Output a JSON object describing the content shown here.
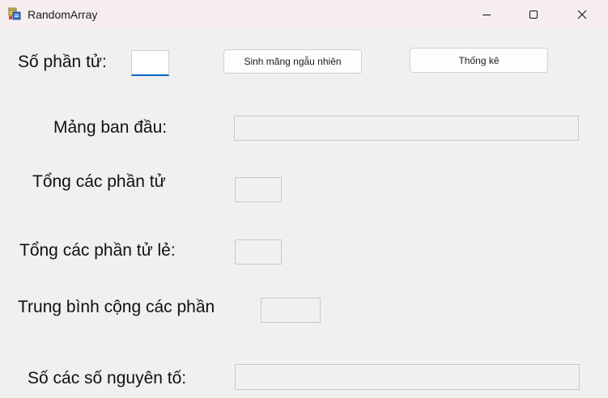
{
  "window": {
    "title": "RandomArray"
  },
  "form": {
    "element_count_label": "Số phần tử:",
    "element_count_value": "",
    "generate_button": "Sinh mãng ngẫu nhiên",
    "stats_button": "Thống kê",
    "original_array_label": "Mảng ban đầu:",
    "original_array_value": "",
    "sum_label": "Tổng các phần tử",
    "sum_value": "",
    "odd_sum_label": "Tổng các phần tử lẻ:",
    "odd_sum_value": "",
    "average_label": "Trung bình cộng các phần",
    "average_value": "",
    "prime_count_label": "Số các số nguyên tố:",
    "prime_count_value": ""
  },
  "icons": {
    "app": "app-form-icon",
    "minimize": "minimize-icon",
    "maximize": "maximize-icon",
    "close": "close-icon"
  },
  "colors": {
    "focus_accent": "#0067c0",
    "titlebar": "#f6eeee",
    "background": "#f0f0f0"
  }
}
